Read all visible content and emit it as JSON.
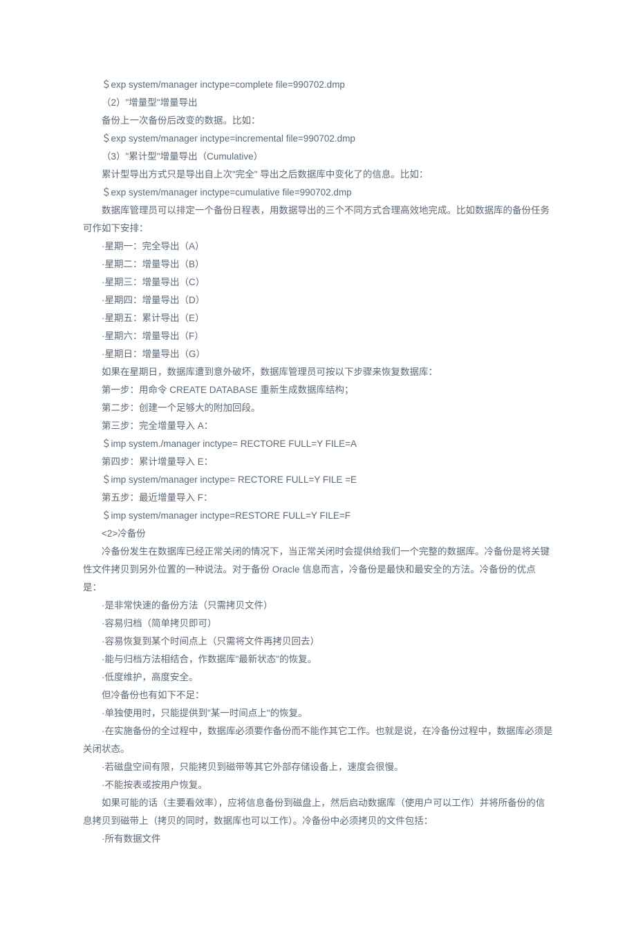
{
  "lines": [
    "＄exp system/manager inctype=complete file=990702.dmp",
    "（2）\"增量型\"增量导出",
    "备份上一次备份后改变的数据。比如：",
    "＄exp system/manager inctype=incremental file=990702.dmp",
    "（3）\"累计型\"增量导出（Cumulative）",
    "累计型导出方式只是导出自上次\"完全\" 导出之后数据库中变化了的信息。比如：",
    "＄exp system/manager inctype=cumulative file=990702.dmp",
    "数据库管理员可以排定一个备份日程表，用数据导出的三个不同方式合理高效地完成。比如数据库的备份任务可作如下安排：",
    "·星期一：完全导出（A）",
    "·星期二：增量导出（B）",
    "·星期三：增量导出（C）",
    "·星期四：增量导出（D）",
    "·星期五：累计导出（E）",
    "·星期六：增量导出（F）",
    "·星期日：增量导出（G）",
    "如果在星期日，数据库遭到意外破坏，数据库管理员可按以下步骤来恢复数据库：",
    "第一步：用命令 CREATE DATABASE 重新生成数据库结构；",
    "第二步：创建一个足够大的附加回段。",
    "第三步：完全增量导入 A：",
    "＄imp system./manager inctype= RECTORE FULL=Y FILE=A",
    "第四步：累计增量导入 E：",
    "＄imp system/manager inctype= RECTORE FULL=Y FILE =E",
    "第五步：最近增量导入 F：",
    "＄imp system/manager inctype=RESTORE FULL=Y FILE=F",
    "<2>冷备份",
    "冷备份发生在数据库已经正常关闭的情况下，当正常关闭时会提供给我们一个完整的数据库。冷备份是将关键性文件拷贝到另外位置的一种说法。对于备份 Oracle 信息而言，冷备份是最快和最安全的方法。冷备份的优点是：",
    "·是非常快速的备份方法（只需拷贝文件）",
    "·容易归档（简单拷贝即可）",
    "·容易恢复到某个时间点上（只需将文件再拷贝回去）",
    "·能与归档方法相结合，作数据库\"最新状态\"的恢复。",
    "·低度维护，高度安全。",
    "但冷备份也有如下不足：",
    "·单独使用时，只能提供到\"某一时间点上\"的恢复。",
    "·在实施备份的全过程中，数据库必须要作备份而不能作其它工作。也就是说，在冷备份过程中，数据库必须是关闭状态。",
    "·若磁盘空间有限，只能拷贝到磁带等其它外部存储设备上，速度会很慢。",
    "·不能按表或按用户恢复。",
    "如果可能的话（主要看效率），应将信息备份到磁盘上，然后启动数据库（使用户可以工作）并将所备份的信息拷贝到磁带上（拷贝的同时，数据库也可以工作）。冷备份中必须拷贝的文件包括：",
    "·所有数据文件"
  ]
}
